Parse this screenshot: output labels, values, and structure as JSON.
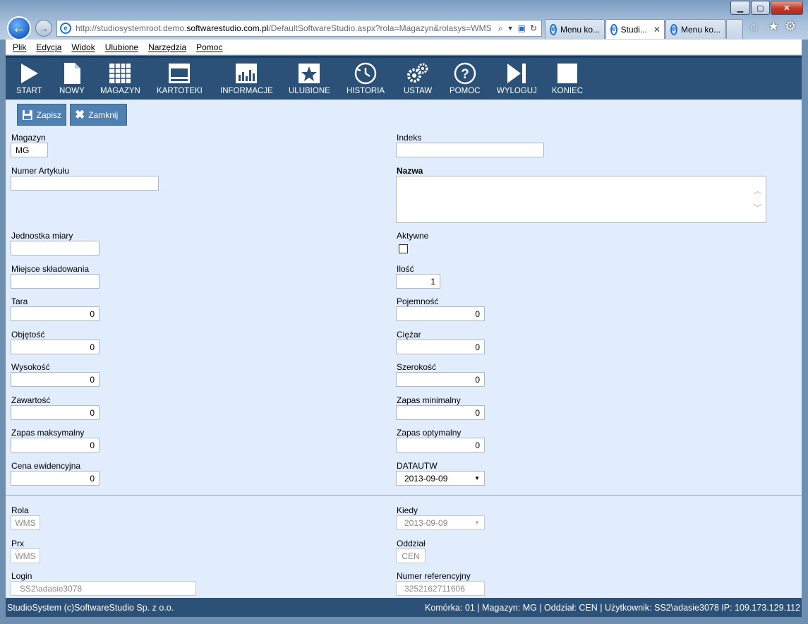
{
  "browser": {
    "url_prefix": "http://studiosystemroot.demo.",
    "url_domain": "softwarestudio.com.pl",
    "url_suffix": "/DefaultSoftwareStudio.aspx?rola=Magazyn&rolasys=WMS",
    "tabs": [
      {
        "label": "Menu ko...",
        "active": false
      },
      {
        "label": "Studi...",
        "active": true
      },
      {
        "label": "Menu ko...",
        "active": false
      }
    ],
    "tab_close": "✕"
  },
  "menu": [
    "Plik",
    "Edycja",
    "Widok",
    "Ulubione",
    "Narzędzia",
    "Pomoc"
  ],
  "toolbar": {
    "start": "START",
    "nowy": "NOWY",
    "magazyn": "MAGAZYN",
    "kartoteki": "KARTOTEKI",
    "informacje": "INFORMACJE",
    "ulubione": "ULUBIONE",
    "historia": "HISTORIA",
    "ustaw": "USTAW",
    "pomoc": "POMOC",
    "wyloguj": "WYLOGUJ",
    "koniec": "KONIEC"
  },
  "actions": {
    "save": "Zapisz",
    "close": "Zamknij"
  },
  "form": {
    "magazyn": {
      "label": "Magazyn",
      "value": "MG"
    },
    "indeks": {
      "label": "Indeks",
      "value": ""
    },
    "numer_artykulu": {
      "label": "Numer Artykułu",
      "value": ""
    },
    "nazwa": {
      "label": "Nazwa",
      "value": ""
    },
    "jednostka": {
      "label": "Jednostka miary",
      "value": ""
    },
    "aktywne": {
      "label": "Aktywne",
      "checked": false
    },
    "miejsce": {
      "label": "Miejsce składowania",
      "value": ""
    },
    "ilosc": {
      "label": "Ilość",
      "value": "1"
    },
    "tara": {
      "label": "Tara",
      "value": "0"
    },
    "pojemnosc": {
      "label": "Pojemność",
      "value": "0"
    },
    "objetosc": {
      "label": "Objętość",
      "value": "0"
    },
    "ciezar": {
      "label": "Ciężar",
      "value": "0"
    },
    "wysokosc": {
      "label": "Wysokość",
      "value": "0"
    },
    "szerokosc": {
      "label": "Szerokość",
      "value": "0"
    },
    "zawartosc": {
      "label": "Zawartość",
      "value": "0"
    },
    "zapas_min": {
      "label": "Zapas minimalny",
      "value": "0"
    },
    "zapas_max": {
      "label": "Zapas maksymalny",
      "value": "0"
    },
    "zapas_opt": {
      "label": "Zapas optymalny",
      "value": "0"
    },
    "cena": {
      "label": "Cena ewidencyjna",
      "value": "0"
    },
    "datautw": {
      "label": "DATAUTW",
      "value": "2013-09-09"
    }
  },
  "meta": {
    "rola": {
      "label": "Rola",
      "value": "WMS"
    },
    "kiedy": {
      "label": "Kiedy",
      "value": "2013-09-09"
    },
    "prx": {
      "label": "Prx",
      "value": "WMS"
    },
    "oddzial": {
      "label": "Oddział",
      "value": "CEN"
    },
    "login": {
      "label": "Login",
      "value": "SS2\\adasie3078"
    },
    "numer_ref": {
      "label": "Numer referencyjny",
      "value": "3252162711606"
    }
  },
  "status": {
    "left": "StudioSystem (c)SoftwareStudio Sp. z o.o.",
    "right": "Komórka: 01 | Magazyn: MG | Oddział: CEN | Użytkownik: SS2\\adasie3078 IP: 109.173.129.112"
  },
  "icons": [
    "back-arrow-icon",
    "forward-arrow-icon",
    "ie-icon",
    "search-icon",
    "refresh-icon",
    "home-icon",
    "star-icon",
    "gear-icon"
  ],
  "colors": {
    "toolbar": "#2b5179",
    "content": "#e1edfd",
    "button": "#4f80b2"
  }
}
